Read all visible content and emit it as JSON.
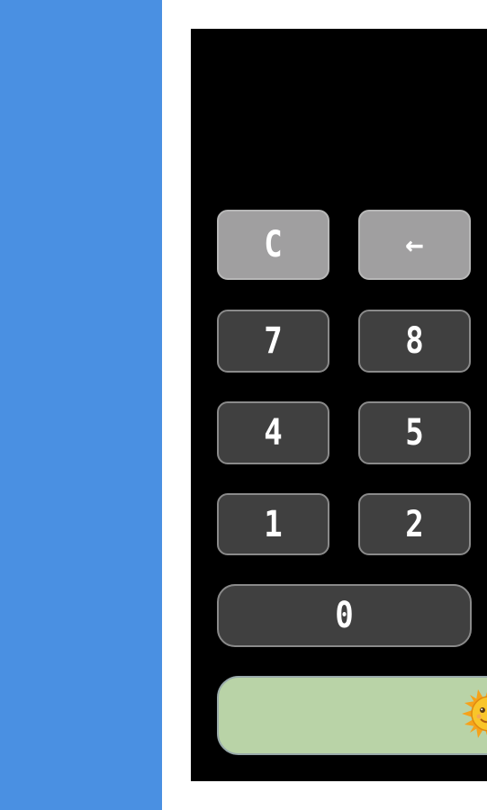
{
  "display": {
    "value": ""
  },
  "keys": {
    "clear": "C",
    "backspace": "←",
    "k7": "7",
    "k8": "8",
    "k4": "4",
    "k5": "5",
    "k1": "1",
    "k2": "2",
    "k0": "0"
  },
  "action_bar": {
    "icon": "sun-face-icon"
  },
  "colors": {
    "sidebar": "#4a90e2",
    "calculator_bg": "#000000",
    "number_key": "#404040",
    "function_key": "#a09fa0",
    "action_key": "#b9d3a7"
  }
}
